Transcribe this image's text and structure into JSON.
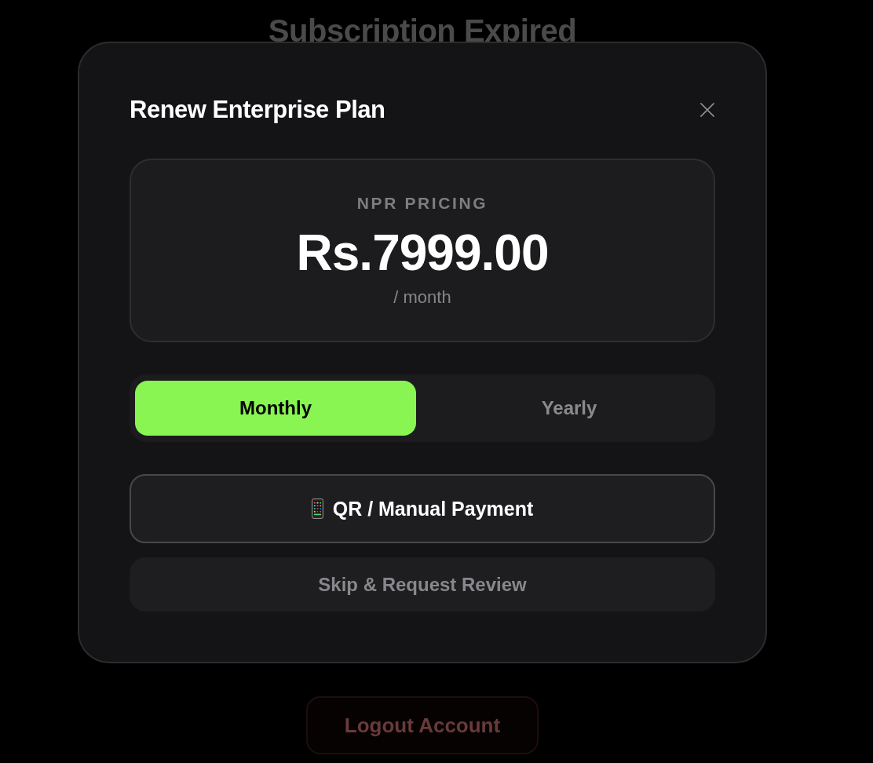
{
  "background": {
    "title": "Subscription Expired",
    "logout_button": "Logout Account"
  },
  "modal": {
    "title": "Renew Enterprise Plan",
    "price_card": {
      "label": "NPR PRICING",
      "price": "Rs.7999.00",
      "period": "/ month"
    },
    "billing_toggle": [
      {
        "label": "Monthly",
        "selected": true
      },
      {
        "label": "Yearly",
        "selected": false
      }
    ],
    "buttons": [
      {
        "kind": "primary",
        "label": "QR / Manual Payment"
      },
      {
        "kind": "secondary",
        "label": "Skip & Request Review"
      }
    ]
  }
}
